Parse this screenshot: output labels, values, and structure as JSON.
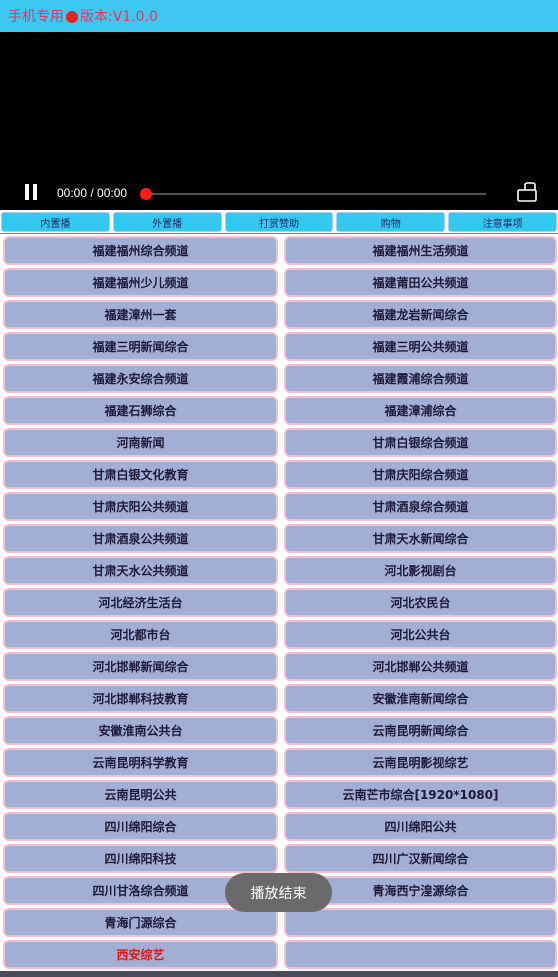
{
  "title": {
    "prefix": "手机专用",
    "suffix": "版本:V1.0.0",
    "icon": "tomato-icon"
  },
  "player": {
    "time": "00:00 / 00:00",
    "progress": 0
  },
  "tabs": [
    "内置播",
    "外置播",
    "打赏赞助",
    "购物",
    "注意事项"
  ],
  "channels": [
    "福建福州综合频道",
    "福建福州生活频道",
    "福建福州少儿频道",
    "福建莆田公共频道",
    "福建漳州一套",
    "福建龙岩新闻综合",
    "福建三明新闻综合",
    "福建三明公共频道",
    "福建永安综合频道",
    "福建霞浦综合频道",
    "福建石狮综合",
    "福建漳浦综合",
    "河南新闻",
    "甘肃白银综合频道",
    "甘肃白银文化教育",
    "甘肃庆阳综合频道",
    "甘肃庆阳公共频道",
    "甘肃酒泉综合频道",
    "甘肃酒泉公共频道",
    "甘肃天水新闻综合",
    "甘肃天水公共频道",
    "河北影视剧台",
    "河北经济生活台",
    "河北农民台",
    "河北都市台",
    "河北公共台",
    "河北邯郸新闻综合",
    "河北邯郸公共频道",
    "河北邯郸科技教育",
    "安徽淮南新闻综合",
    "安徽淮南公共台",
    "云南昆明新闻综合",
    "云南昆明科学教育",
    "云南昆明影视综艺",
    "云南昆明公共",
    "云南芒市综合[1920*1080]",
    "四川绵阳综合",
    "四川绵阳公共",
    "四川绵阳科技",
    "四川广汉新闻综合",
    "四川甘洛综合频道",
    "青海西宁湟源综合",
    "青海门源综合",
    "",
    "西安综艺",
    ""
  ],
  "highlighted_channel": "西安综艺",
  "toast": "播放结束",
  "colors": {
    "titlebar": "#3cc8f0",
    "title_text": "#e8336a",
    "tab": "#34c8f0",
    "cell": "#a2aed2",
    "cell_border": "#f3bfc8",
    "highlight": "#e21818"
  }
}
